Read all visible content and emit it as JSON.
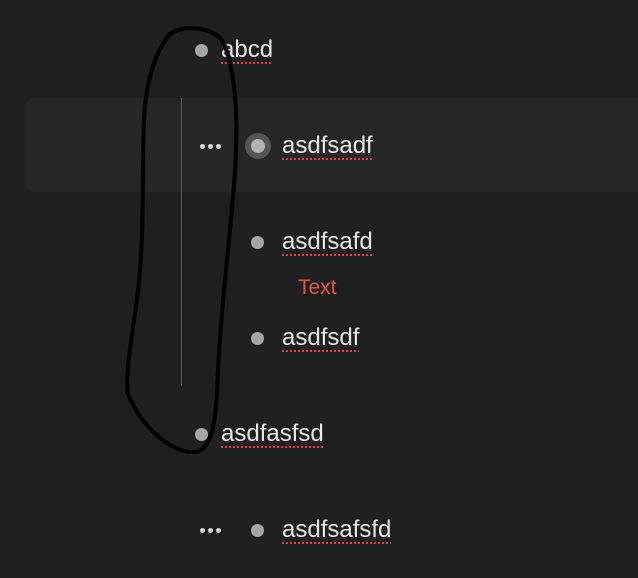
{
  "outline": {
    "items": [
      {
        "text": "abcd"
      },
      {
        "text": "asdfsadf"
      },
      {
        "text": "asdfsafd"
      },
      {
        "text": "asdfsdf"
      },
      {
        "text": "asdfasfsd"
      },
      {
        "text": "asdfsafsfd"
      }
    ],
    "note": "Text"
  },
  "icons": {
    "bullet": "bullet-dot-icon",
    "more": "ellipsis-icon"
  },
  "colors": {
    "background": "#1f1f1f",
    "text": "#e8e8e8",
    "spell_underline": "#e0443a",
    "note_text": "#e0574a",
    "bullet": "#a6a6a6"
  }
}
